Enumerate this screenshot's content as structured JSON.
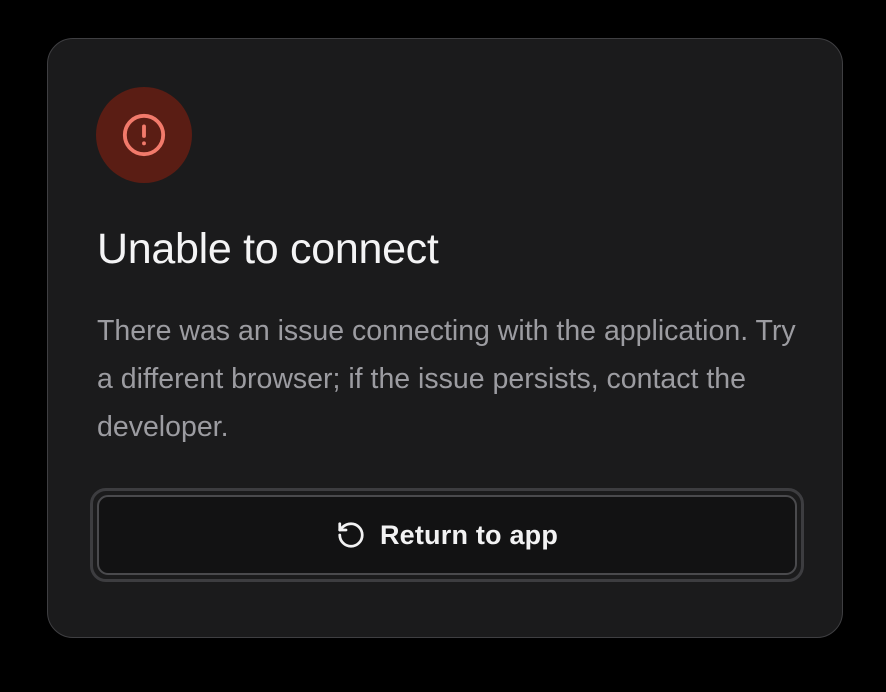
{
  "dialog": {
    "title": "Unable to connect",
    "description": "There was an issue connecting with the application. Try a different browser; if the issue persists, contact the developer.",
    "icon": "alert-circle-icon",
    "return_button": {
      "label": "Return to app",
      "icon": "refresh-ccw-icon"
    }
  },
  "colors": {
    "page_background": "#000000",
    "card_background": "#1b1b1c",
    "card_border": "#3f3f42",
    "alert_badge_background": "#5a1d14",
    "alert_icon": "#f27a6b",
    "title_text": "#f4f4f5",
    "body_text": "#9c9ca1",
    "button_background": "#121213",
    "button_text": "#f2f2f3"
  }
}
